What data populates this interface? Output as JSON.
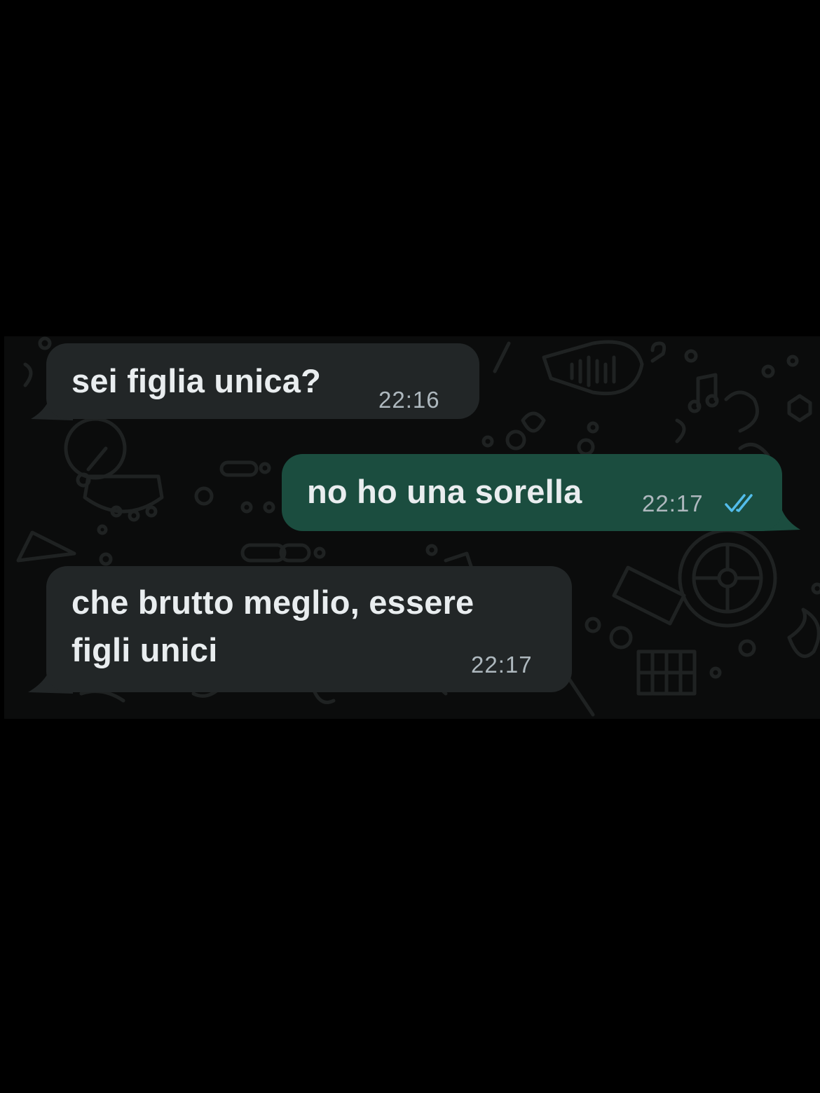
{
  "messages": [
    {
      "direction": "incoming",
      "text": "sei figlia unica?",
      "time": "22:16"
    },
    {
      "direction": "outgoing",
      "text": "no ho una sorella",
      "time": "22:17",
      "status_icon": "double-check-read-icon"
    },
    {
      "direction": "incoming",
      "text": "che brutto meglio, essere\nfigli unici",
      "time": "22:17"
    }
  ],
  "colors": {
    "incoming_bubble": "#222627",
    "outgoing_bubble": "#1b4d3f",
    "read_ticks": "#53bdeb",
    "background": "#0b0c0c"
  }
}
